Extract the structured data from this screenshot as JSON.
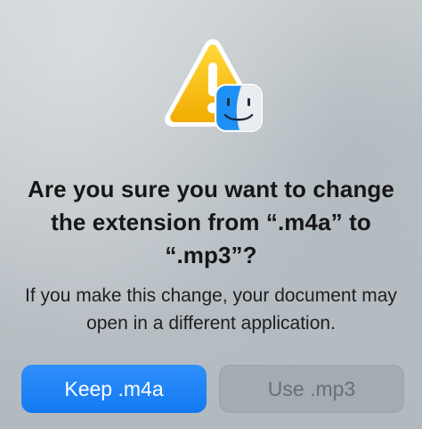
{
  "dialog": {
    "icon": "warning-triangle-icon",
    "badge": "finder-icon",
    "title": "Are you sure you want to change the extension from “.m4a” to “.mp3”?",
    "message": "If you make this change, your document may open in a different application.",
    "primary_button": "Keep .m4a",
    "secondary_button": "Use .mp3"
  },
  "colors": {
    "primary_button": "#1479f2",
    "warning": "#f5b800",
    "finder_blue": "#1e90f5"
  }
}
